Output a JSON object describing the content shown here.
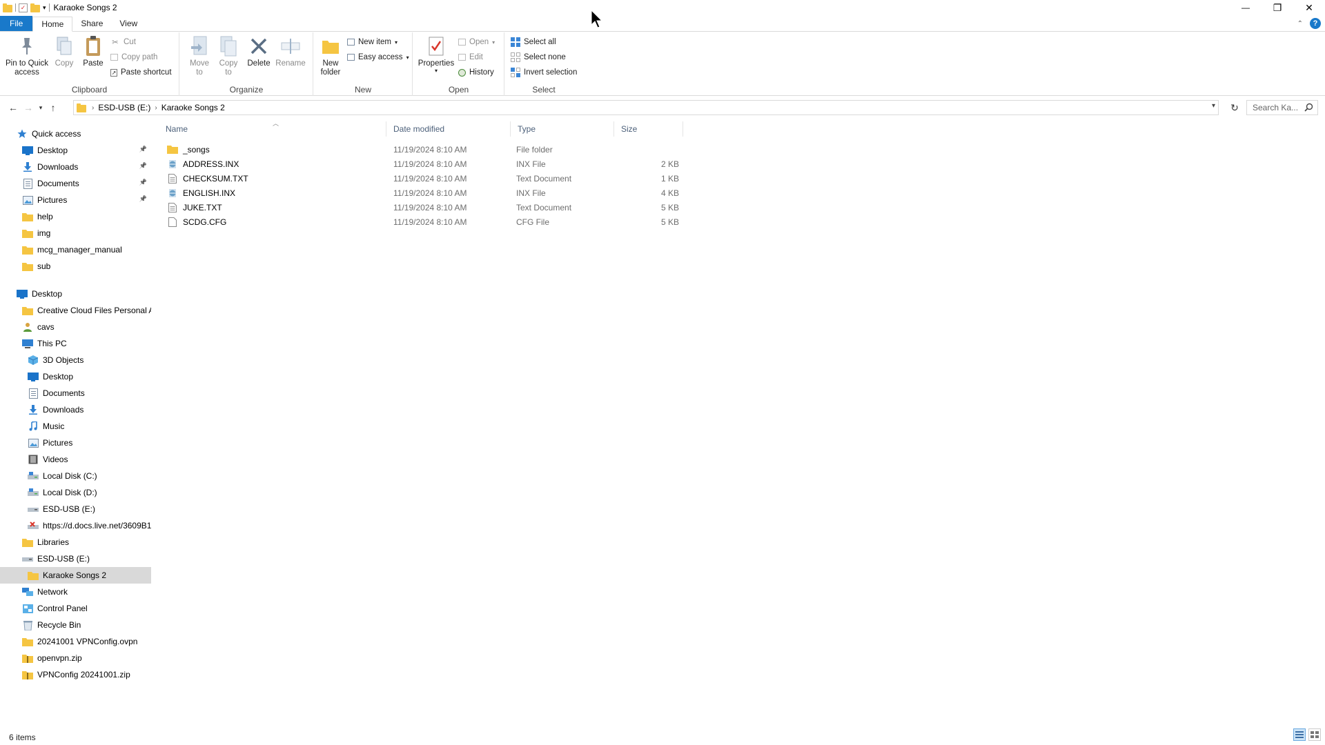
{
  "window": {
    "title": "Karaoke Songs 2",
    "controls": {
      "minimize": "—",
      "restore": "❐",
      "close": "✕"
    }
  },
  "ribbon_tabs": [
    {
      "label": "File"
    },
    {
      "label": "Home"
    },
    {
      "label": "Share"
    },
    {
      "label": "View"
    }
  ],
  "ribbon": {
    "clipboard": {
      "label": "Clipboard",
      "pin": "Pin to Quick access",
      "pin_l1": "Pin to Quick",
      "pin_l2": "access",
      "copy": "Copy",
      "paste": "Paste",
      "cut": "Cut",
      "copy_path": "Copy path",
      "paste_shortcut": "Paste shortcut"
    },
    "organize": {
      "label": "Organize",
      "move_l1": "Move",
      "move_l2": "to",
      "copy_l1": "Copy",
      "copy_l2": "to",
      "delete": "Delete",
      "rename": "Rename"
    },
    "new": {
      "label": "New",
      "folder_l1": "New",
      "folder_l2": "folder",
      "new_item": "New item",
      "easy_access": "Easy access"
    },
    "open": {
      "label": "Open",
      "properties": "Properties",
      "open": "Open",
      "edit": "Edit",
      "history": "History"
    },
    "select": {
      "label": "Select",
      "select_all": "Select all",
      "select_none": "Select none",
      "invert": "Invert selection"
    }
  },
  "address": {
    "crumbs": [
      "ESD-USB (E:)",
      "Karaoke Songs 2"
    ],
    "search_placeholder": "Search Ka..."
  },
  "nav": [
    {
      "label": "Quick access",
      "icon": "star-icon",
      "indent": 0,
      "pinned": false
    },
    {
      "label": "Desktop",
      "icon": "desktop-icon",
      "indent": 1,
      "pinned": true
    },
    {
      "label": "Downloads",
      "icon": "download-icon",
      "indent": 1,
      "pinned": true
    },
    {
      "label": "Documents",
      "icon": "documents-icon",
      "indent": 1,
      "pinned": true
    },
    {
      "label": "Pictures",
      "icon": "pictures-icon",
      "indent": 1,
      "pinned": true
    },
    {
      "label": "help",
      "icon": "folder-icon",
      "indent": 1,
      "pinned": false
    },
    {
      "label": "img",
      "icon": "folder-icon",
      "indent": 1,
      "pinned": false
    },
    {
      "label": "mcg_manager_manual",
      "icon": "folder-icon",
      "indent": 1,
      "pinned": false
    },
    {
      "label": "sub",
      "icon": "folder-icon",
      "indent": 1,
      "pinned": false
    },
    {
      "label": "",
      "icon": "",
      "indent": 0,
      "pinned": false,
      "spacer": true
    },
    {
      "label": "Desktop",
      "icon": "desktop-icon",
      "indent": 0,
      "pinned": false
    },
    {
      "label": "Creative Cloud Files Personal Ac",
      "icon": "folder-icon",
      "indent": 1,
      "pinned": false
    },
    {
      "label": "cavs",
      "icon": "user-icon",
      "indent": 1,
      "pinned": false
    },
    {
      "label": "This PC",
      "icon": "pc-icon",
      "indent": 1,
      "pinned": false
    },
    {
      "label": "3D Objects",
      "icon": "cube-icon",
      "indent": 2,
      "pinned": false
    },
    {
      "label": "Desktop",
      "icon": "desktop-icon",
      "indent": 2,
      "pinned": false
    },
    {
      "label": "Documents",
      "icon": "documents-icon",
      "indent": 2,
      "pinned": false
    },
    {
      "label": "Downloads",
      "icon": "download-icon",
      "indent": 2,
      "pinned": false
    },
    {
      "label": "Music",
      "icon": "music-icon",
      "indent": 2,
      "pinned": false
    },
    {
      "label": "Pictures",
      "icon": "pictures-icon",
      "indent": 2,
      "pinned": false
    },
    {
      "label": "Videos",
      "icon": "video-icon",
      "indent": 2,
      "pinned": false
    },
    {
      "label": "Local Disk (C:)",
      "icon": "disk-icon",
      "indent": 2,
      "pinned": false
    },
    {
      "label": "Local Disk (D:)",
      "icon": "disk-icon",
      "indent": 2,
      "pinned": false
    },
    {
      "label": "ESD-USB (E:)",
      "icon": "usb-drive-icon",
      "indent": 2,
      "pinned": false
    },
    {
      "label": "https://d.docs.live.net/3609B1",
      "icon": "network-drive-error-icon",
      "indent": 2,
      "pinned": false
    },
    {
      "label": "Libraries",
      "icon": "folder-icon",
      "indent": 1,
      "pinned": false
    },
    {
      "label": "ESD-USB (E:)",
      "icon": "usb-drive-icon",
      "indent": 1,
      "pinned": false
    },
    {
      "label": "Karaoke Songs 2",
      "icon": "folder-icon",
      "indent": 2,
      "pinned": false,
      "selected": true
    },
    {
      "label": "Network",
      "icon": "network-icon",
      "indent": 1,
      "pinned": false
    },
    {
      "label": "Control Panel",
      "icon": "control-panel-icon",
      "indent": 1,
      "pinned": false
    },
    {
      "label": "Recycle Bin",
      "icon": "recycle-bin-icon",
      "indent": 1,
      "pinned": false
    },
    {
      "label": "20241001 VPNConfig.ovpn",
      "icon": "folder-icon",
      "indent": 1,
      "pinned": false
    },
    {
      "label": "openvpn.zip",
      "icon": "zip-folder-icon",
      "indent": 1,
      "pinned": false
    },
    {
      "label": "VPNConfig 20241001.zip",
      "icon": "zip-folder-icon",
      "indent": 1,
      "pinned": false
    }
  ],
  "columns": {
    "name": "Name",
    "date": "Date modified",
    "type": "Type",
    "size": "Size"
  },
  "files": [
    {
      "name": "_songs",
      "date": "11/19/2024 8:10 AM",
      "type": "File folder",
      "size": "",
      "icon": "folder-icon"
    },
    {
      "name": "ADDRESS.INX",
      "date": "11/19/2024 8:10 AM",
      "type": "INX File",
      "size": "2 KB",
      "icon": "inx-file-icon"
    },
    {
      "name": "CHECKSUM.TXT",
      "date": "11/19/2024 8:10 AM",
      "type": "Text Document",
      "size": "1 KB",
      "icon": "text-file-icon"
    },
    {
      "name": "ENGLISH.INX",
      "date": "11/19/2024 8:10 AM",
      "type": "INX File",
      "size": "4 KB",
      "icon": "inx-file-icon"
    },
    {
      "name": "JUKE.TXT",
      "date": "11/19/2024 8:10 AM",
      "type": "Text Document",
      "size": "5 KB",
      "icon": "text-file-icon"
    },
    {
      "name": "SCDG.CFG",
      "date": "11/19/2024 8:10 AM",
      "type": "CFG File",
      "size": "5 KB",
      "icon": "blank-file-icon"
    }
  ],
  "status": {
    "item_count": "6 items"
  },
  "colors": {
    "file_tab": "#1979ca",
    "selection": "#d9d9d9",
    "header_text": "#4c607a",
    "folder": "#f5c542"
  }
}
